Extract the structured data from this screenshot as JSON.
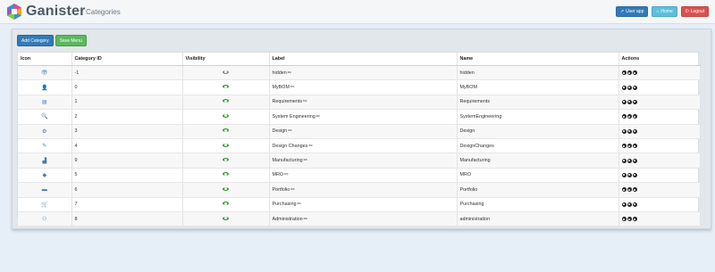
{
  "header": {
    "brand": "Ganister",
    "page_title": "Categories",
    "buttons": {
      "user_app": "User app",
      "home": "Home",
      "logout": "Logout"
    }
  },
  "toolbar": {
    "add_category": "Add Category",
    "save_menu": "Save Menu"
  },
  "table": {
    "columns": [
      "Icon",
      "Category ID",
      "Visibility",
      "Label",
      "Name",
      "Actions"
    ],
    "rows": [
      {
        "icon": "eye-icon",
        "id": "-1",
        "visible": false,
        "label": "hidden",
        "name": "hidden"
      },
      {
        "icon": "user-icon",
        "id": "0",
        "visible": true,
        "label": "MyBOM",
        "name": "MyBOM"
      },
      {
        "icon": "file-icon",
        "id": "1",
        "visible": true,
        "label": "Requirements",
        "name": "Requirements"
      },
      {
        "icon": "search-icon",
        "id": "2",
        "visible": true,
        "label": "System Engineering",
        "name": "SystemEngineering"
      },
      {
        "icon": "cogs-icon",
        "id": "3",
        "visible": true,
        "label": "Design",
        "name": "Design"
      },
      {
        "icon": "pencil-icon",
        "id": "4",
        "visible": true,
        "label": "Design Changes",
        "name": "DesignChanges"
      },
      {
        "icon": "industry-icon",
        "id": "9",
        "visible": true,
        "label": "Manufacturing",
        "name": "Manufacturing"
      },
      {
        "icon": "tag-icon",
        "id": "5",
        "visible": true,
        "label": "MRO",
        "name": "MRO"
      },
      {
        "icon": "folder-icon",
        "id": "6",
        "visible": true,
        "label": "Portfolio",
        "name": "Portfolio"
      },
      {
        "icon": "cart-icon",
        "id": "7",
        "visible": true,
        "label": "Purchasing",
        "name": "Purchasing"
      },
      {
        "icon": "users-cog-icon",
        "id": "8",
        "visible": true,
        "label": "Administration",
        "name": "administration"
      }
    ]
  },
  "colors": {
    "primary": "#337ab7",
    "info": "#5bc0de",
    "danger": "#d9534f",
    "success": "#5cb85c",
    "icon_blue": "#3a7abf",
    "visible_green": "#3a9b3a"
  }
}
